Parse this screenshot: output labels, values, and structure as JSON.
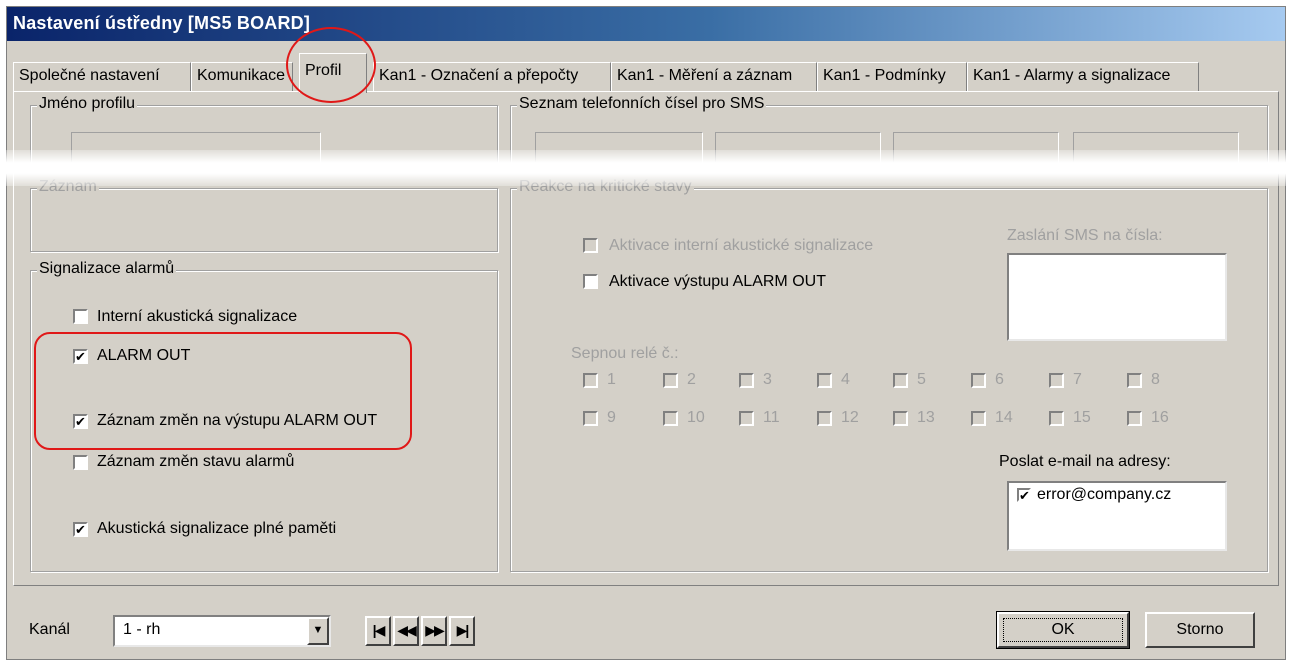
{
  "window": {
    "title": "Nastavení ústředny [MS5 BOARD]"
  },
  "tabs": [
    {
      "label": "Společné nastavení"
    },
    {
      "label": "Komunikace"
    },
    {
      "label": "Profil"
    },
    {
      "label": "Kan1 - Označení a přepočty"
    },
    {
      "label": "Kan1 - Měření a záznam"
    },
    {
      "label": "Kan1 - Podmínky"
    },
    {
      "label": "Kan1 - Alarmy a signalizace"
    }
  ],
  "profile_name": {
    "title": "Jméno profilu",
    "value": ""
  },
  "record": {
    "title": "Záznam"
  },
  "sms_numbers": {
    "title": "Seznam telefonních čísel pro SMS",
    "values": [
      "",
      "",
      "",
      ""
    ]
  },
  "alarm_signal": {
    "title": "Signalizace alarmů",
    "items": [
      {
        "label": "Interní akustická signalizace",
        "checked": false
      },
      {
        "label": "ALARM OUT",
        "checked": true
      },
      {
        "label": "Záznam změn na výstupu ALARM OUT",
        "checked": true
      },
      {
        "label": "Záznam změn stavu alarmů",
        "checked": false
      },
      {
        "label": "Akustická signalizace plné paměti",
        "checked": true
      }
    ]
  },
  "critical": {
    "title": "Reakce na kritické stavy",
    "internal_label": "Aktivace interní akustické signalizace",
    "alarm_out_label": "Aktivace výstupu ALARM OUT",
    "relays_label": "Sepnou relé č.:",
    "relays": [
      "1",
      "2",
      "3",
      "4",
      "5",
      "6",
      "7",
      "8",
      "9",
      "10",
      "11",
      "12",
      "13",
      "14",
      "15",
      "16"
    ],
    "sms_label": "Zaslání SMS na čísla:",
    "email_label": "Poslat e-mail na adresy:",
    "emails": [
      {
        "address": "error@company.cz",
        "checked": true
      }
    ]
  },
  "footer": {
    "channel_label": "Kanál",
    "channel_value": "1 - rh",
    "ok_label": "OK",
    "cancel_label": "Storno",
    "check_mark": "✔",
    "nav": [
      "|◀",
      "◀◀",
      "▶▶",
      "▶|"
    ],
    "dropdown_arrow": "▼"
  },
  "colors": {
    "annotation": "#e01818",
    "title_bar": "#0a246a"
  }
}
